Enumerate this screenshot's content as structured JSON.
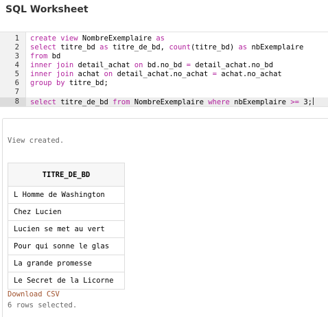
{
  "header": {
    "title": "SQL Worksheet"
  },
  "editor": {
    "active_line": 8,
    "lines": [
      {
        "n": "1",
        "parts": [
          [
            "kw",
            "create"
          ],
          [
            "t",
            " "
          ],
          [
            "kw",
            "view"
          ],
          [
            "t",
            " NombreExemplaire "
          ],
          [
            "kw",
            "as"
          ]
        ]
      },
      {
        "n": "2",
        "parts": [
          [
            "kw",
            "select"
          ],
          [
            "t",
            " titre_bd "
          ],
          [
            "kw",
            "as"
          ],
          [
            "t",
            " titre_de_bd, "
          ],
          [
            "fn",
            "count"
          ],
          [
            "t",
            "(titre_bd) "
          ],
          [
            "kw",
            "as"
          ],
          [
            "t",
            " nbExemplaire"
          ]
        ]
      },
      {
        "n": "3",
        "parts": [
          [
            "kw",
            "from"
          ],
          [
            "t",
            " bd"
          ]
        ]
      },
      {
        "n": "4",
        "parts": [
          [
            "kw",
            "inner"
          ],
          [
            "t",
            " "
          ],
          [
            "kw",
            "join"
          ],
          [
            "t",
            " detail_achat "
          ],
          [
            "kw",
            "on"
          ],
          [
            "t",
            " bd.no_bd "
          ],
          [
            "op",
            "="
          ],
          [
            "t",
            " detail_achat.no_bd"
          ]
        ]
      },
      {
        "n": "5",
        "parts": [
          [
            "kw",
            "inner"
          ],
          [
            "t",
            " "
          ],
          [
            "kw",
            "join"
          ],
          [
            "t",
            " achat "
          ],
          [
            "kw",
            "on"
          ],
          [
            "t",
            " detail_achat.no_achat "
          ],
          [
            "op",
            "="
          ],
          [
            "t",
            " achat.no_achat"
          ]
        ]
      },
      {
        "n": "6",
        "parts": [
          [
            "kw",
            "group"
          ],
          [
            "t",
            " "
          ],
          [
            "kw",
            "by"
          ],
          [
            "t",
            " titre_bd;"
          ]
        ]
      },
      {
        "n": "7",
        "parts": []
      },
      {
        "n": "8",
        "parts": [
          [
            "kw",
            "select"
          ],
          [
            "t",
            " titre_de_bd "
          ],
          [
            "kw",
            "from"
          ],
          [
            "t",
            " NombreExemplaire "
          ],
          [
            "kw",
            "where"
          ],
          [
            "t",
            " nbExemplaire "
          ],
          [
            "op",
            ">="
          ],
          [
            "t",
            " 3;"
          ]
        ]
      }
    ]
  },
  "results": {
    "status": "View created.",
    "column": "TITRE_DE_BD",
    "rows": [
      "L Homme de Washington",
      "Chez Lucien",
      "Lucien se met au vert",
      "Pour qui sonne le glas",
      "La grande promesse",
      "Le Secret de la Licorne"
    ],
    "download_label": "Download CSV",
    "rows_selected": "6 rows selected."
  },
  "colors": {
    "keyword": "#b3239e",
    "link": "#a0522d"
  }
}
